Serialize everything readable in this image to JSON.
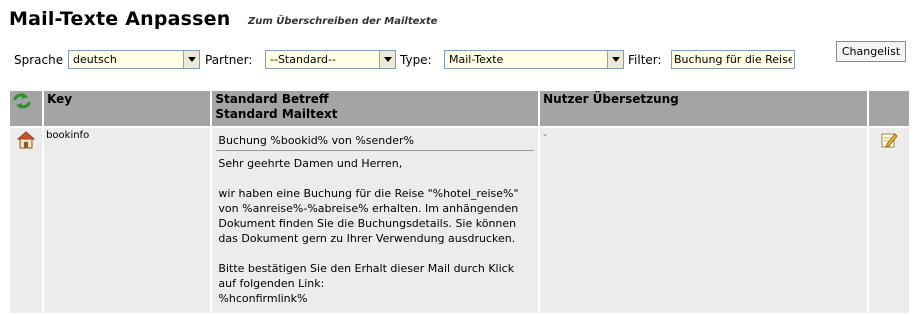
{
  "page": {
    "title": "Mail-Texte Anpassen",
    "subtitle": "Zum Überschreiben der Mailtexte"
  },
  "filters": {
    "sprache_label": "Sprache",
    "sprache_value": "deutsch",
    "partner_label": "Partner:",
    "partner_value": "--Standard--",
    "type_label": "Type:",
    "type_value": "Mail-Texte",
    "filter_label": "Filter:",
    "filter_value": "Buchung für die Reise",
    "changelist_label": "Changelist"
  },
  "table": {
    "header_icon": "refresh-arrows-icon",
    "col_key": "Key",
    "col_standard_line1": "Standard Betreff",
    "col_standard_line2": "Standard Mailtext",
    "col_user": "Nutzer Übersetzung",
    "rows": [
      {
        "row_icon": "home-icon",
        "key": "bookinfo",
        "subject": "Buchung %bookid% von %sender%",
        "body": "Sehr geehrte Damen und Herren,\n\nwir haben eine Buchung für die Reise \"%hotel_reise%\" von %anreise%-%abreise% erhalten. Im anhängenden Dokument finden Sie die Buchungsdetails. Sie können das Dokument gern zu Ihrer Verwendung ausdrucken.\n\nBitte bestätigen Sie den Erhalt dieser Mail durch Klick auf folgenden Link:\n%hconfirmlink%",
        "translation": "-",
        "edit_icon": "edit-pencil-icon"
      }
    ]
  },
  "colors": {
    "header_bg": "#a4a4a4",
    "cell_bg": "#ececec",
    "input_bg": "#ffffe6"
  }
}
